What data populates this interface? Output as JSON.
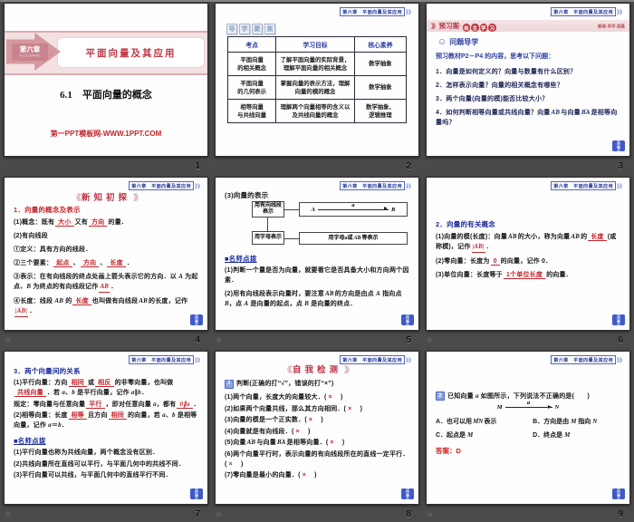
{
  "colors": {
    "background": "#4a4a4a",
    "accent_red": "#c2252c",
    "accent_pink": "#d5989f",
    "accent_blue": "#2c3f9f",
    "badge_blue": "#3f5ac8"
  },
  "chrome": {
    "page_numbers": [
      "1",
      "2",
      "3",
      "4",
      "5",
      "6",
      "7",
      "8",
      "9"
    ],
    "corner_star": "☆"
  },
  "common": {
    "chapter_chip": "第六章　平面向量及其应用",
    "chip_chevron": "》》",
    "deco_wing_left": "《《",
    "deco_wing_right": "》》",
    "badge_line1": "栏目",
    "badge_line2": "导引",
    "tip_heading": "■名师点拨"
  },
  "slide1": {
    "chapter": "第六章",
    "chapter_pinyin": "DI LIU ZHANG",
    "title": "平面向量及其应用",
    "subtitle": "6.1　平面向量的概念",
    "watermark": "第一PPT模板网-WWW.1PPT.COM"
  },
  "slide2": {
    "section_tag_chars": [
      "导",
      "学",
      "聚",
      "焦"
    ],
    "table": {
      "headers": [
        "考点",
        "学习目标",
        "核心素养"
      ],
      "rows": [
        [
          "平面向量\n的相关概念",
          "了解平面向量的实际背景，\n理解平面向量的相关概念",
          "数学抽象"
        ],
        [
          "平面向量\n的几何表示",
          "掌握向量的表示方法，理解\n向量的模的概念",
          "数学抽象"
        ],
        [
          "相等向量\n与共线向量",
          "理解两个向量相等的含义以\n及共线向量的概念",
          "数学抽象、\n逻辑推理"
        ]
      ]
    }
  },
  "slide3": {
    "band_chevrons": "》》",
    "band_title": "预习案·",
    "band_circle_chars": [
      "自",
      "主",
      "学",
      "习"
    ],
    "band_right": "解读·导学·固基",
    "lead_icon": "☺",
    "lead_title": "问题导学",
    "intro": "预习教材P2－P4 的内容，思考以下问题：",
    "questions": [
      [
        {
          "t": "1．向量是如何定义的？向量与数量有什么区别？"
        }
      ],
      [
        {
          "t": "2．怎样表示向量？向量的相关概念有哪些？"
        }
      ],
      [
        {
          "t": "3．两个向量(向量的模)能否比较大小？"
        }
      ],
      [
        {
          "t": "4．如何判断相等向量或共线向量？向量"
        },
        {
          "t": "AB",
          "c": "vec"
        },
        {
          "t": "与向量"
        },
        {
          "t": "BA",
          "c": "vec"
        },
        {
          "t": "是相等向量吗？"
        }
      ]
    ]
  },
  "slide4": {
    "deco_title": "新知初探",
    "title": "1．向量的概念及表示",
    "lines": [
      [
        {
          "t": "(1)概念：既有"
        },
        {
          "t": "大小",
          "c": "blank"
        },
        {
          "t": "又有"
        },
        {
          "t": "方向",
          "c": "blank"
        },
        {
          "t": "的量．"
        }
      ],
      [
        {
          "t": "(2)有向线段"
        }
      ],
      [
        {
          "t": "①定义：具有方向的线段．"
        }
      ],
      [
        {
          "t": "②三个要素："
        },
        {
          "t": "起点",
          "c": "blank"
        },
        {
          "t": "、"
        },
        {
          "t": "方向",
          "c": "blank"
        },
        {
          "t": "、"
        },
        {
          "t": "长度",
          "c": "blank"
        },
        {
          "t": "．"
        }
      ],
      [
        {
          "t": "③表示：在有向线段的终点处画上箭头表示它的方向．以 "
        },
        {
          "t": "A",
          "c": "it"
        },
        {
          "t": " 为起点、"
        },
        {
          "t": "B",
          "c": "it"
        },
        {
          "t": " 为终点的有向线段记作"
        },
        {
          "t": "AB",
          "c": "vec blank"
        },
        {
          "t": "．"
        }
      ],
      [
        {
          "t": "④长度：线段 "
        },
        {
          "t": "AB",
          "c": "it"
        },
        {
          "t": " 的"
        },
        {
          "t": "长度",
          "c": "blank"
        },
        {
          "t": "也叫做有向线段"
        },
        {
          "t": "AB",
          "c": "vec"
        },
        {
          "t": "的长度，记作"
        },
        {
          "t": "|AB|",
          "c": "vec blank"
        },
        {
          "t": "．"
        }
      ]
    ]
  },
  "slide5": {
    "heading": "(3)向量的表示",
    "flow": {
      "left_top": "用有向线段表示",
      "left_bottom": "用字母表示",
      "diagram": {
        "start": "A",
        "end": "B",
        "label": "a"
      },
      "bottom_segs": [
        {
          "t": "用字母 "
        },
        {
          "t": "a",
          "c": "it b"
        },
        {
          "t": " 或 "
        },
        {
          "t": "AB",
          "c": "vec"
        },
        {
          "t": " 等表示"
        }
      ]
    },
    "tips": [
      [
        {
          "t": "(1)判断一个量是否为向量，就要看它是否具备大小和方向两个因素．"
        }
      ],
      [
        {
          "t": "(2)用有向线段表示向量时，要注意"
        },
        {
          "t": "AB",
          "c": "vec"
        },
        {
          "t": "的方向是由点 "
        },
        {
          "t": "A",
          "c": "it"
        },
        {
          "t": " 指向点 "
        },
        {
          "t": "B",
          "c": "it"
        },
        {
          "t": "，点 "
        },
        {
          "t": "A",
          "c": "it"
        },
        {
          "t": " 是向量的起点，点 "
        },
        {
          "t": "B",
          "c": "it"
        },
        {
          "t": " 是向量的终点．"
        }
      ]
    ]
  },
  "slide6": {
    "title": "2．向量的有关概念",
    "lines": [
      [
        {
          "t": "(1)向量的模(长度)：向量"
        },
        {
          "t": "AB",
          "c": "vec"
        },
        {
          "t": "的大小，称为向量"
        },
        {
          "t": "AB",
          "c": "vec"
        },
        {
          "t": "的"
        },
        {
          "t": "长度",
          "c": "blank"
        },
        {
          "t": "(或称模)，记作"
        },
        {
          "t": "|AB|",
          "c": "vec blank"
        },
        {
          "t": "．"
        }
      ],
      [
        {
          "t": "(2)零向量：长度为"
        },
        {
          "t": "0",
          "c": "blank"
        },
        {
          "t": "的向量，记作 "
        },
        {
          "t": "0",
          "c": "b"
        },
        {
          "t": "．"
        }
      ],
      [
        {
          "t": "(3)单位向量：长度等于"
        },
        {
          "t": "1个单位长度",
          "c": "blank"
        },
        {
          "t": "的向量．"
        }
      ]
    ]
  },
  "slide7": {
    "title": "3．两个向量间的关系",
    "lines": [
      [
        {
          "t": "(1)平行向量：方向"
        },
        {
          "t": "相同",
          "c": "blank"
        },
        {
          "t": "或"
        },
        {
          "t": "相反",
          "c": "blank"
        },
        {
          "t": "的非零向量，也叫做"
        },
        {
          "t": "共线向量",
          "c": "blank"
        },
        {
          "t": "．若 "
        },
        {
          "t": "a",
          "c": "it b"
        },
        {
          "t": "、"
        },
        {
          "t": "b",
          "c": "it b"
        },
        {
          "t": " 是平行向量，记作 "
        },
        {
          "t": "a",
          "c": "it b"
        },
        {
          "t": "∥"
        },
        {
          "t": "b",
          "c": "it b"
        },
        {
          "t": "．"
        }
      ],
      [
        {
          "t": "规定：零向量与任意向量"
        },
        {
          "t": "平行",
          "c": "blank"
        },
        {
          "t": "，即对任意向量 "
        },
        {
          "t": "a",
          "c": "it b"
        },
        {
          "t": "，都有"
        },
        {
          "t": "0∥a",
          "c": "blank it"
        },
        {
          "t": "．"
        }
      ],
      [
        {
          "t": "(2)相等向量：长度"
        },
        {
          "t": "相等",
          "c": "blank"
        },
        {
          "t": "且方向"
        },
        {
          "t": "相同",
          "c": "blank"
        },
        {
          "t": "的向量，若 "
        },
        {
          "t": "a",
          "c": "it b"
        },
        {
          "t": "、"
        },
        {
          "t": "b",
          "c": "it b"
        },
        {
          "t": " 是相等向量，记作 "
        },
        {
          "t": "a",
          "c": "it b"
        },
        {
          "t": "＝"
        },
        {
          "t": "b",
          "c": "it b"
        },
        {
          "t": "．"
        }
      ]
    ],
    "tips": [
      [
        {
          "t": "(1)平行向量也称为共线向量，两个概念没有区别．"
        }
      ],
      [
        {
          "t": "(2)共线向量所在直线可以平行，与平面几何中的共线不同．"
        }
      ],
      [
        {
          "t": "(3)平行向量可以共线，与平面几何中的直线平行不同．"
        }
      ]
    ]
  },
  "slide8": {
    "deco_title": "自我检测",
    "qnum": "1",
    "intro": "判断(正确的打“√”，错误的打“×”)",
    "items": [
      [
        {
          "t": "(1)两个向量，长度大的向量较大．("
        },
        {
          "t": "×",
          "c": "cross"
        },
        {
          "t": "　)"
        }
      ],
      [
        {
          "t": "(2)如果两个向量共线，那么其方向相同．("
        },
        {
          "t": "×",
          "c": "cross"
        },
        {
          "t": "　)"
        }
      ],
      [
        {
          "t": "(3)向量的模是一个正实数．("
        },
        {
          "t": "×",
          "c": "cross"
        },
        {
          "t": "　)"
        }
      ],
      [
        {
          "t": "(4)向量就是有向线段．("
        },
        {
          "t": "×",
          "c": "cross"
        },
        {
          "t": "　)"
        }
      ],
      [
        {
          "t": "(5)向量"
        },
        {
          "t": "AB",
          "c": "vec"
        },
        {
          "t": "与向量"
        },
        {
          "t": "BA",
          "c": "vec"
        },
        {
          "t": "是相等向量．("
        },
        {
          "t": "×",
          "c": "cross"
        },
        {
          "t": "　)"
        }
      ],
      [
        {
          "t": "(6)两个向量平行时，表示向量的有向线段所在的直线一定平行．("
        },
        {
          "t": "×",
          "c": "cross"
        },
        {
          "t": "　)"
        }
      ],
      [
        {
          "t": "(7)零向量是最小的向量．("
        },
        {
          "t": "×",
          "c": "cross"
        },
        {
          "t": "　)"
        }
      ]
    ]
  },
  "slide9": {
    "qnum": "2",
    "question": [
      {
        "t": "已知向量 "
      },
      {
        "t": "a",
        "c": "it b"
      },
      {
        "t": " 如图所示，下列说法不正确的是(　　)"
      }
    ],
    "diagram": {
      "start": "M",
      "end": "N",
      "label": "a"
    },
    "options": [
      [
        {
          "t": "A．也可以用"
        },
        {
          "t": "MN",
          "c": "vec"
        },
        {
          "t": "表示"
        }
      ],
      [
        {
          "t": "B．方向是由 "
        },
        {
          "t": "M",
          "c": "it"
        },
        {
          "t": " 指向 "
        },
        {
          "t": "N",
          "c": "it"
        }
      ],
      [
        {
          "t": "C．起点是 "
        },
        {
          "t": "M",
          "c": "it"
        }
      ],
      [
        {
          "t": "D．终点是 "
        },
        {
          "t": "M",
          "c": "it"
        }
      ]
    ],
    "answer": "答案：D"
  }
}
